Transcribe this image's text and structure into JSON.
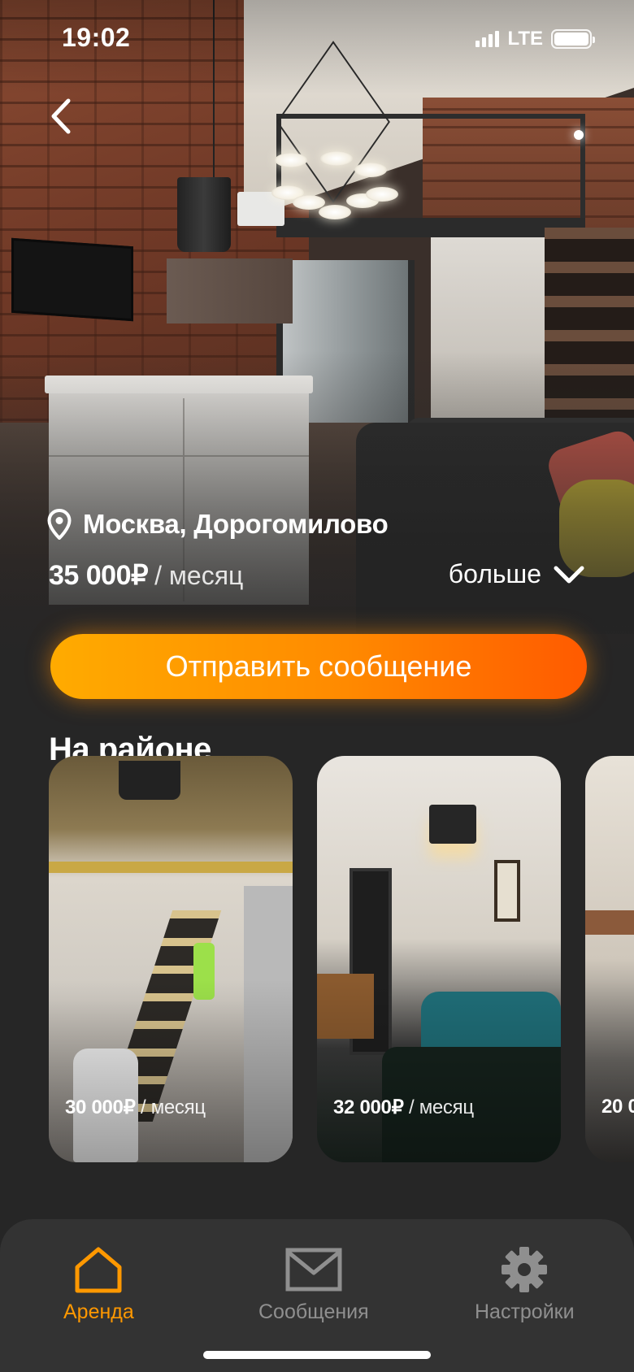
{
  "status_bar": {
    "time": "19:02",
    "network": "LTE"
  },
  "listing": {
    "location": "Москва, Дорогомилово",
    "price": "35 000₽",
    "price_unit": "/ месяц",
    "more_label": "больше"
  },
  "cta": {
    "label": "Отправить сообщение"
  },
  "nearby": {
    "title": "На районе",
    "cards": [
      {
        "price": "30 000₽",
        "unit": "/ месяц"
      },
      {
        "price": "32 000₽",
        "unit": "/ месяц"
      },
      {
        "price": "20 0",
        "unit": ""
      }
    ]
  },
  "tabs": [
    {
      "label": "Аренда",
      "icon": "home-icon",
      "active": true
    },
    {
      "label": "Сообщения",
      "icon": "mail-icon",
      "active": false
    },
    {
      "label": "Настройки",
      "icon": "gear-icon",
      "active": false
    }
  ],
  "colors": {
    "accent": "#FF9800",
    "background": "#262626",
    "tabbar": "#333333",
    "inactive": "#8F8F8F"
  }
}
